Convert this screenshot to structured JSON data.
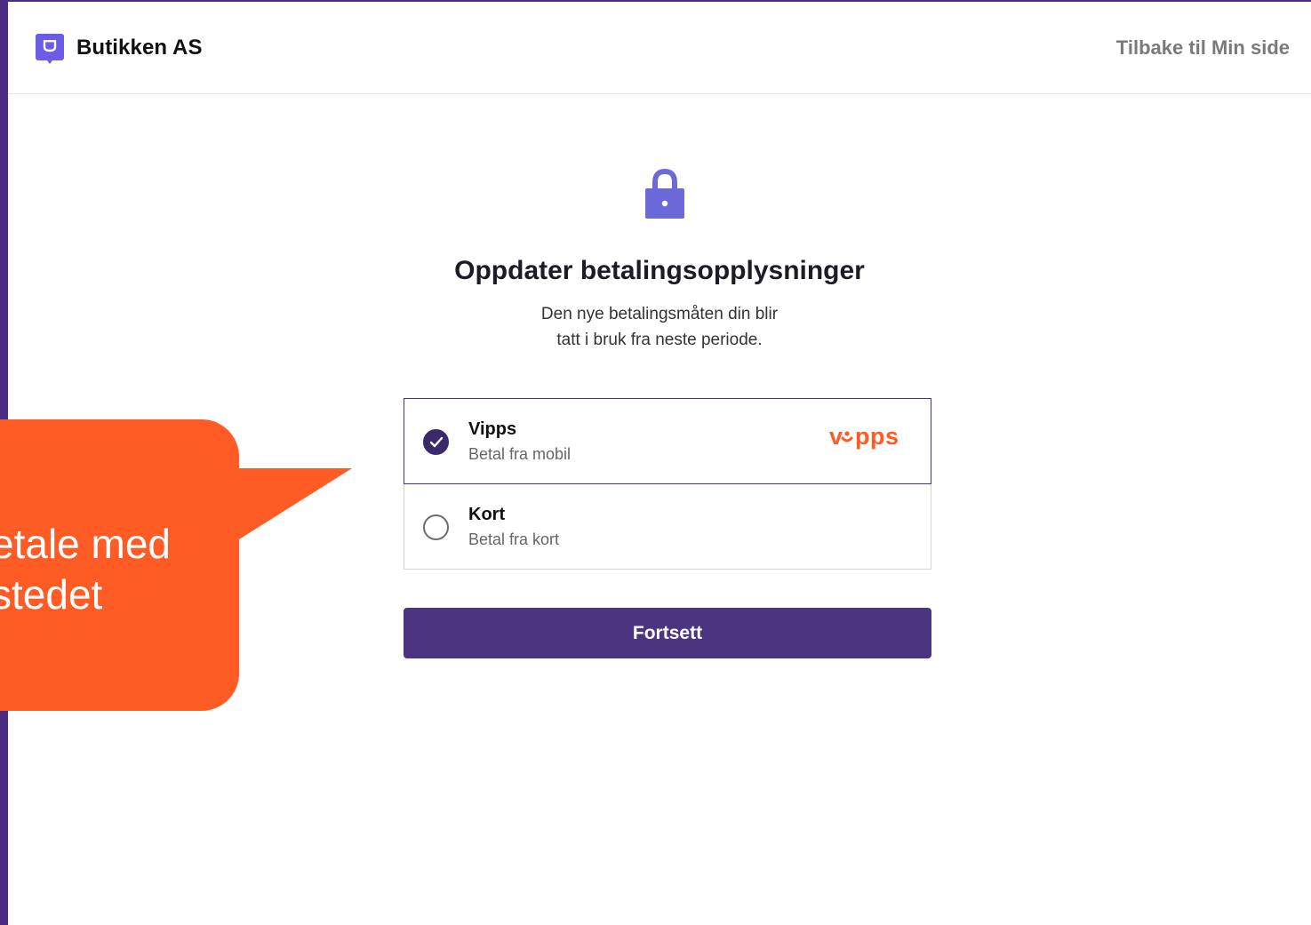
{
  "header": {
    "brand_name": "Butikken AS",
    "back_link": "Tilbake til Min side"
  },
  "main": {
    "title": "Oppdater betalingsopplysninger",
    "subtitle_line1": "Den nye betalingsmåten din blir",
    "subtitle_line2": "tatt i bruk fra neste periode.",
    "options": [
      {
        "title": "Vipps",
        "subtitle": "Betal fra mobil",
        "selected": true,
        "logo_text": "vipps"
      },
      {
        "title": "Kort",
        "subtitle": "Betal fra kort",
        "selected": false
      }
    ],
    "continue_label": "Fortsett"
  },
  "callout": {
    "line1": "etale med",
    "line2": "stedet"
  },
  "colors": {
    "brand_purple": "#4b2e83",
    "accent_orange": "#ff5b24",
    "lock_icon": "#6c6ad8"
  }
}
